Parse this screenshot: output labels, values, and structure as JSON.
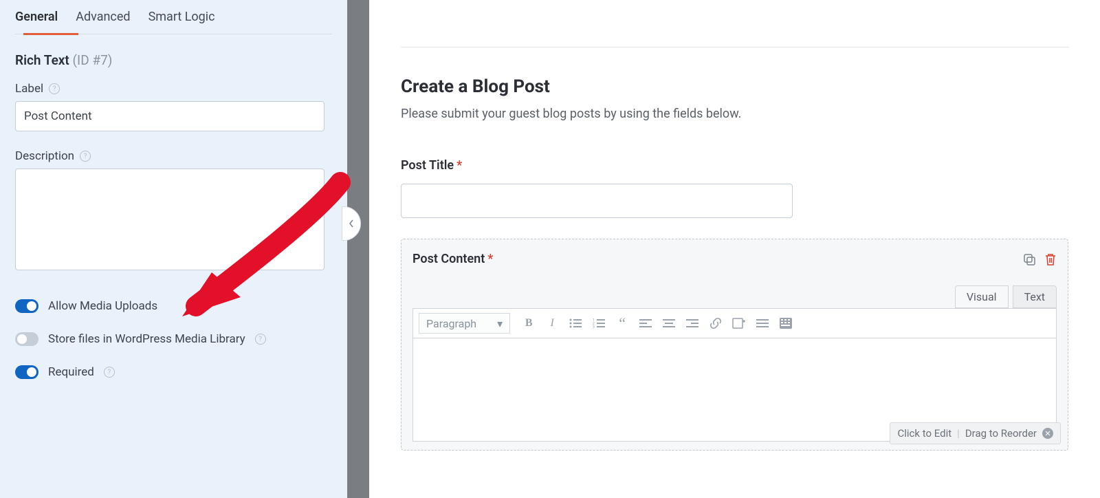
{
  "sidebar": {
    "tabs": {
      "general": "General",
      "advanced": "Advanced",
      "smart": "Smart Logic"
    },
    "field_type": "Rich Text",
    "field_id": "(ID #7)",
    "label_label": "Label",
    "label_value": "Post Content",
    "description_label": "Description",
    "description_value": "",
    "toggles": {
      "allow_media": "Allow Media Uploads",
      "store_media": "Store files in WordPress Media Library",
      "required": "Required"
    }
  },
  "main": {
    "heading": "Create a Blog Post",
    "subheading": "Please submit your guest blog posts by using the fields below.",
    "post_title_label": "Post Title",
    "post_content_label": "Post Content",
    "editor_tabs": {
      "visual": "Visual",
      "text": "Text"
    },
    "paragraph_label": "Paragraph",
    "footer_hint": {
      "edit": "Click to Edit",
      "reorder": "Drag to Reorder"
    }
  }
}
